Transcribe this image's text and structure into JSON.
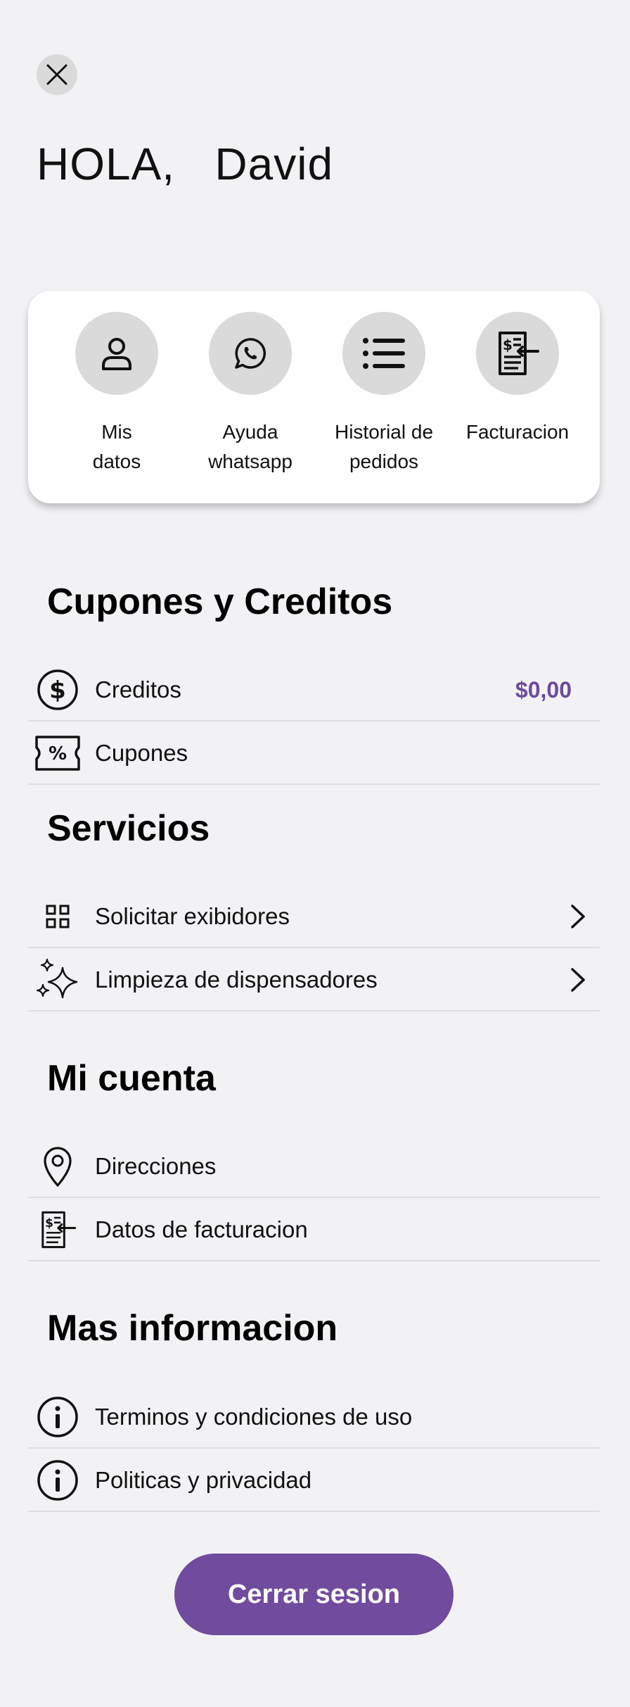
{
  "greeting": {
    "prefix": "HOLA,",
    "name": "David"
  },
  "quick_actions": [
    {
      "label": "Mis\ndatos",
      "icon": "user-icon"
    },
    {
      "label": "Ayuda\nwhatsapp",
      "icon": "whatsapp-icon"
    },
    {
      "label": "Historial de\npedidos",
      "icon": "list-icon"
    },
    {
      "label": "Facturacion",
      "icon": "invoice-icon"
    }
  ],
  "sections": {
    "cupones": {
      "title": "Cupones y Creditos",
      "items": [
        {
          "label": "Creditos",
          "value": "$0,00",
          "icon": "dollar-circle-icon"
        },
        {
          "label": "Cupones",
          "icon": "coupon-icon"
        }
      ]
    },
    "servicios": {
      "title": "Servicios",
      "items": [
        {
          "label": "Solicitar exibidores",
          "icon": "grid-icon"
        },
        {
          "label": "Limpieza de dispensadores",
          "icon": "sparkles-icon"
        }
      ]
    },
    "cuenta": {
      "title": "Mi cuenta",
      "items": [
        {
          "label": "Direcciones",
          "icon": "location-pin-icon"
        },
        {
          "label": "Datos de facturacion",
          "icon": "invoice-icon"
        }
      ]
    },
    "info": {
      "title": "Mas informacion",
      "items": [
        {
          "label": "Terminos y condiciones de uso",
          "icon": "info-icon"
        },
        {
          "label": "Politicas y privacidad",
          "icon": "info-icon"
        }
      ]
    }
  },
  "logout_label": "Cerrar sesion",
  "colors": {
    "accent": "#714b9d",
    "credit_value": "#6e4a9c",
    "background": "#f2f2f5"
  }
}
